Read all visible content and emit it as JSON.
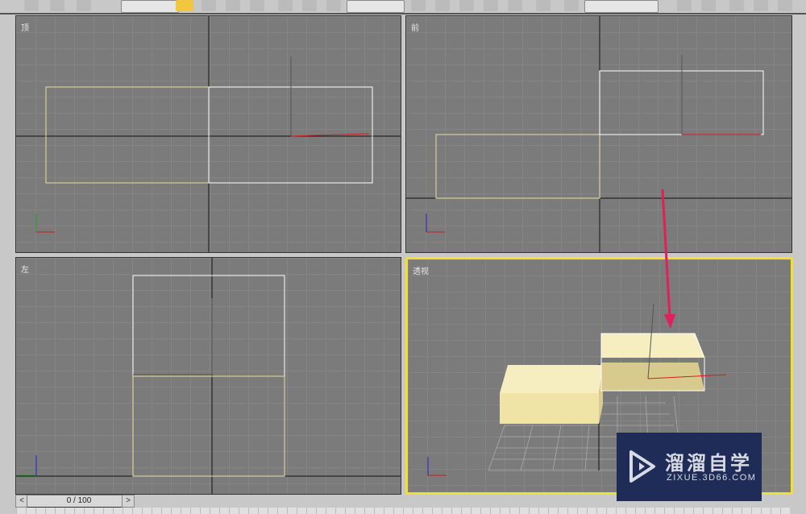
{
  "viewports": {
    "top": {
      "label": "顶"
    },
    "front": {
      "label": "前"
    },
    "left": {
      "label": "左"
    },
    "perspective": {
      "label": "透视"
    }
  },
  "axes": {
    "x": "x",
    "y": "y",
    "z": "z"
  },
  "timeline": {
    "frame": "0 / 100",
    "prev": "<",
    "next": ">"
  },
  "watermark": {
    "title": "溜溜自学",
    "url": "ZIXUE.3D66.COM"
  },
  "colors": {
    "active_border": "#f0e030",
    "arrow": "#e0205a",
    "box": "#f0e0a0",
    "watermark_bg": "#1f2c57"
  }
}
